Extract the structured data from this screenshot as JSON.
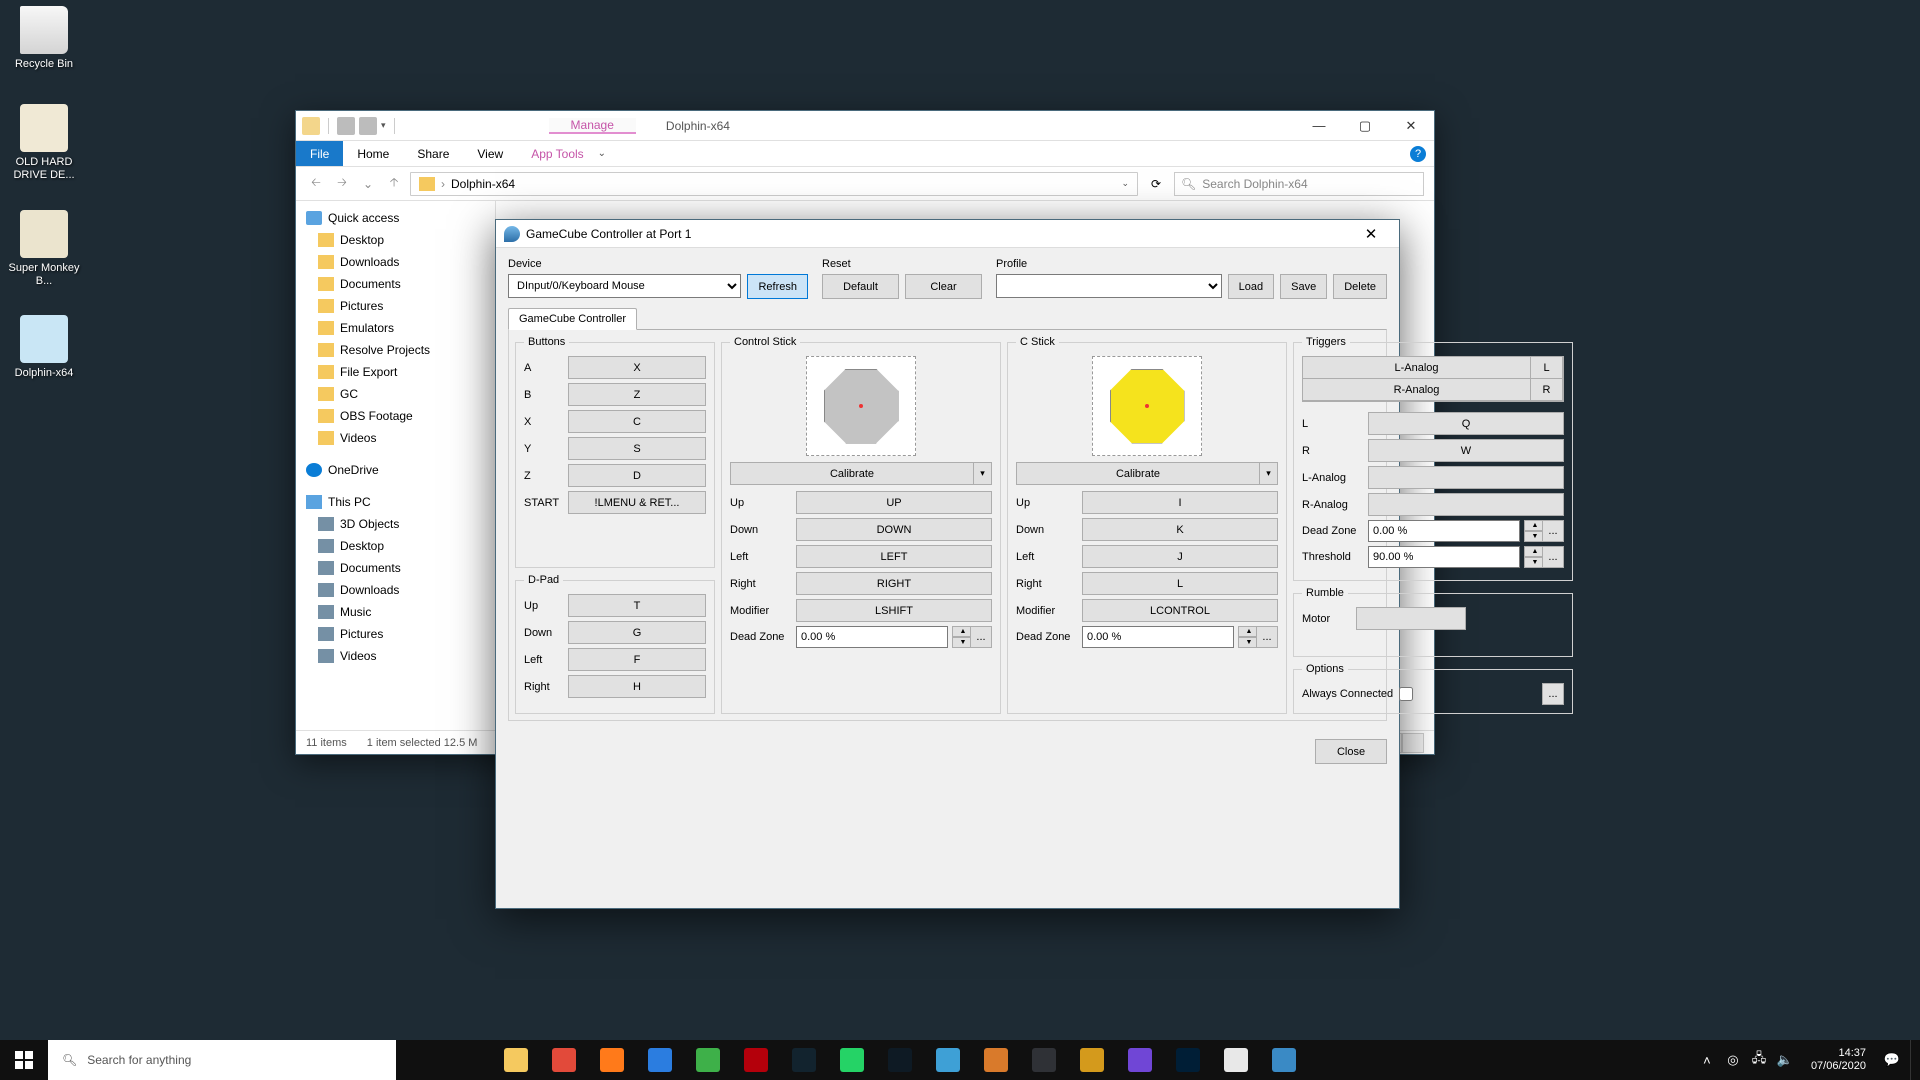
{
  "desktop": {
    "icons": [
      {
        "label": "Recycle Bin"
      },
      {
        "label": "OLD HARD DRIVE DE..."
      },
      {
        "label": "Super Monkey B..."
      },
      {
        "label": "Dolphin-x64"
      }
    ]
  },
  "explorer": {
    "ribbon_context": "Manage",
    "app_title": "Dolphin-x64",
    "tabs": {
      "file": "File",
      "home": "Home",
      "share": "Share",
      "view": "View",
      "tools": "App Tools"
    },
    "path": "Dolphin-x64",
    "search_placeholder": "Search Dolphin-x64",
    "nav": {
      "quick": "Quick access",
      "items1": [
        "Desktop",
        "Downloads",
        "Documents",
        "Pictures",
        "Emulators",
        "Resolve Projects",
        "File Export",
        "GC",
        "OBS Footage",
        "Videos"
      ],
      "onedrive": "OneDrive",
      "thispc": "This PC",
      "items2": [
        "3D Objects",
        "Desktop",
        "Documents",
        "Downloads",
        "Music",
        "Pictures",
        "Videos"
      ]
    },
    "status": {
      "items": "11 items",
      "selected": "1 item selected  12.5 M"
    }
  },
  "dialog": {
    "title": "GameCube Controller at Port 1",
    "device": {
      "label": "Device",
      "value": "DInput/0/Keyboard Mouse",
      "refresh": "Refresh"
    },
    "reset": {
      "label": "Reset",
      "default": "Default",
      "clear": "Clear"
    },
    "profile": {
      "label": "Profile",
      "load": "Load",
      "save": "Save",
      "delete": "Delete"
    },
    "tab": "GameCube Controller",
    "buttons": {
      "title": "Buttons",
      "rows": [
        {
          "label": "A",
          "bind": "X"
        },
        {
          "label": "B",
          "bind": "Z"
        },
        {
          "label": "X",
          "bind": "C"
        },
        {
          "label": "Y",
          "bind": "S"
        },
        {
          "label": "Z",
          "bind": "D"
        },
        {
          "label": "START",
          "bind": "!LMENU & RET..."
        }
      ]
    },
    "dpad": {
      "title": "D-Pad",
      "rows": [
        {
          "label": "Up",
          "bind": "T"
        },
        {
          "label": "Down",
          "bind": "G"
        },
        {
          "label": "Left",
          "bind": "F"
        },
        {
          "label": "Right",
          "bind": "H"
        }
      ]
    },
    "control_stick": {
      "title": "Control Stick",
      "calibrate": "Calibrate",
      "rows": [
        {
          "label": "Up",
          "bind": "UP"
        },
        {
          "label": "Down",
          "bind": "DOWN"
        },
        {
          "label": "Left",
          "bind": "LEFT"
        },
        {
          "label": "Right",
          "bind": "RIGHT"
        },
        {
          "label": "Modifier",
          "bind": "LSHIFT"
        }
      ],
      "deadzone_label": "Dead Zone",
      "deadzone": "0.00 %"
    },
    "c_stick": {
      "title": "C Stick",
      "calibrate": "Calibrate",
      "rows": [
        {
          "label": "Up",
          "bind": "I"
        },
        {
          "label": "Down",
          "bind": "K"
        },
        {
          "label": "Left",
          "bind": "J"
        },
        {
          "label": "Right",
          "bind": "L"
        },
        {
          "label": "Modifier",
          "bind": "LCONTROL"
        }
      ],
      "deadzone_label": "Dead Zone",
      "deadzone": "0.00 %"
    },
    "triggers": {
      "title": "Triggers",
      "analog_rows": [
        {
          "big": "L-Analog",
          "small": "L"
        },
        {
          "big": "R-Analog",
          "small": "R"
        }
      ],
      "rows": [
        {
          "label": "L",
          "bind": "Q"
        },
        {
          "label": "R",
          "bind": "W"
        },
        {
          "label": "L-Analog",
          "bind": ""
        },
        {
          "label": "R-Analog",
          "bind": ""
        }
      ],
      "deadzone_label": "Dead Zone",
      "deadzone": "0.00 %",
      "threshold_label": "Threshold",
      "threshold": "90.00 %"
    },
    "rumble": {
      "title": "Rumble",
      "motor": "Motor"
    },
    "options": {
      "title": "Options",
      "always": "Always Connected"
    },
    "close": "Close"
  },
  "taskbar": {
    "search_placeholder": "Search for anything",
    "clock": {
      "time": "14:37",
      "date": "07/06/2020"
    },
    "apps": [
      {
        "name": "cortana",
        "color": "#101010"
      },
      {
        "name": "taskview",
        "color": "#101010"
      },
      {
        "name": "explorer",
        "color": "#f5c95f"
      },
      {
        "name": "chrome",
        "color": "#e24a3a"
      },
      {
        "name": "firefox",
        "color": "#ff7a1a"
      },
      {
        "name": "vscode",
        "color": "#2b7de0"
      },
      {
        "name": "app-green",
        "color": "#3eb049"
      },
      {
        "name": "filezilla",
        "color": "#b4000b"
      },
      {
        "name": "steam",
        "color": "#12232e"
      },
      {
        "name": "whatsapp",
        "color": "#25d366"
      },
      {
        "name": "media",
        "color": "#0e1a24"
      },
      {
        "name": "app-rainbow",
        "color": "#3ea0d6"
      },
      {
        "name": "app-orange",
        "color": "#d97a2b"
      },
      {
        "name": "discord",
        "color": "#2f3136"
      },
      {
        "name": "app-yellow",
        "color": "#d49a1c"
      },
      {
        "name": "amazon",
        "color": "#7046d6"
      },
      {
        "name": "photoshop",
        "color": "#001e36"
      },
      {
        "name": "app-white",
        "color": "#e8e8e8"
      },
      {
        "name": "dolphin",
        "color": "#3a8ac5"
      }
    ]
  }
}
